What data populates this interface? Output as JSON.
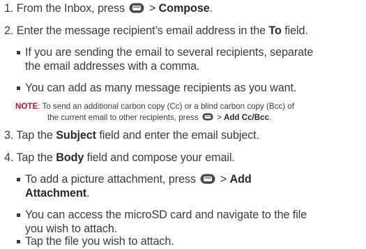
{
  "steps": {
    "s1_prefix": "1. From the Inbox, press ",
    "s1_sep": " > ",
    "s1_bold": "Compose",
    "s1_end": ".",
    "s2_prefix": "2. Enter the message recipient’s email address in the ",
    "s2_bold": "To",
    "s2_end": " field.",
    "b1_line1": "If you are sending the email to several recipients, separate",
    "b1_line2": "the email addresses with a comma.",
    "b2": "You can add as many message recipients as you want.",
    "note_label": "NOTE",
    "note_line1": ": To send an additional carbon copy (Cc) or a blind carbon copy (Bcc) of",
    "note_line2_prefix": "the current email to other recipients, press ",
    "note_sep": " > ",
    "note_bold": "Add Cc/Bcc",
    "note_end": ".",
    "s3_prefix": "3. Tap the ",
    "s3_bold": "Subject",
    "s3_end": " field and enter the email subject.",
    "s4_prefix": "4. Tap the ",
    "s4_bold": "Body",
    "s4_end": " field and compose your email.",
    "b3_prefix": "To add a picture attachment, press ",
    "b3_sep": " > ",
    "b3_bold1": "Add",
    "b3_bold2": "Attachment",
    "b3_end": ".",
    "b4_line1": "You can access the microSD card and navigate to the file",
    "b4_line2": "you wish to attach.",
    "b5": "Tap the file you wish to attach."
  },
  "icons": {
    "menu_key": "menu-key-icon"
  }
}
